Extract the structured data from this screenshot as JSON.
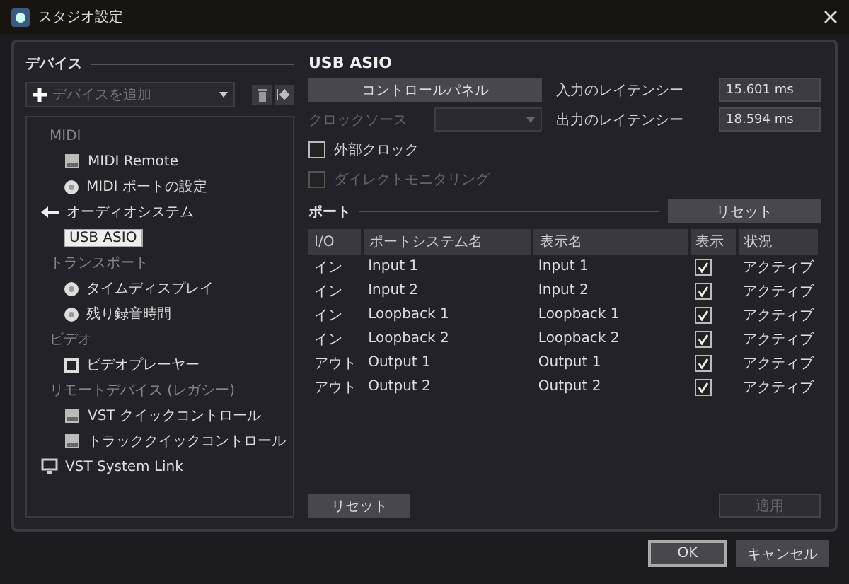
{
  "window": {
    "title": "スタジオ設定"
  },
  "devices": {
    "heading": "デバイス",
    "add_dropdown": {
      "placeholder": "デバイスを追加"
    },
    "tree": [
      {
        "label": "MIDI",
        "kind": "category",
        "selected": false,
        "children": [
          {
            "label": "MIDI Remote",
            "kind": "panel",
            "selected": false
          },
          {
            "label": "MIDI ポートの設定",
            "kind": "dot",
            "selected": false
          }
        ]
      },
      {
        "label": "オーディオシステム",
        "kind": "plug",
        "selected": false,
        "children": [
          {
            "label": "USB ASIO",
            "kind": "plain",
            "selected": true
          }
        ]
      },
      {
        "label": "トランスポート",
        "kind": "category",
        "selected": false,
        "children": [
          {
            "label": "タイムディスプレイ",
            "kind": "dot",
            "selected": false
          },
          {
            "label": "残り録音時間",
            "kind": "dot",
            "selected": false
          }
        ]
      },
      {
        "label": "ビデオ",
        "kind": "category",
        "selected": false,
        "children": [
          {
            "label": "ビデオプレーヤー",
            "kind": "square",
            "selected": false
          }
        ]
      },
      {
        "label": "リモートデバイス (レガシー)",
        "kind": "category",
        "selected": false,
        "children": [
          {
            "label": "VST クイックコントロール",
            "kind": "panel",
            "selected": false
          },
          {
            "label": "トラッククイックコントロール",
            "kind": "panel",
            "selected": false
          }
        ]
      },
      {
        "label": "VST System Link",
        "kind": "monitor",
        "selected": false
      }
    ]
  },
  "detail": {
    "title": "USB ASIO",
    "control_panel_button": "コントロールパネル",
    "clock_source": {
      "label": "クロックソース",
      "disabled": true
    },
    "input_latency": {
      "label": "入力のレイテンシー",
      "value": "15.601 ms"
    },
    "output_latency": {
      "label": "出力のレイテンシー",
      "value": "18.594 ms"
    },
    "options": [
      {
        "label": "外部クロック",
        "checked": false,
        "disabled": false
      },
      {
        "label": "ダイレクトモニタリング",
        "checked": false,
        "disabled": true
      }
    ],
    "ports_heading": "ポート",
    "ports_reset_button": "リセット",
    "table": {
      "columns": [
        "I/O",
        "ポートシステム名",
        "表示名",
        "表示",
        "状況"
      ],
      "rows": [
        {
          "io": "イン",
          "system_name": "Input 1",
          "display_name": "Input 1",
          "visible": true,
          "status": "アクティブ"
        },
        {
          "io": "イン",
          "system_name": "Input 2",
          "display_name": "Input 2",
          "visible": true,
          "status": "アクティブ"
        },
        {
          "io": "イン",
          "system_name": "Loopback 1",
          "display_name": "Loopback 1",
          "visible": true,
          "status": "アクティブ"
        },
        {
          "io": "イン",
          "system_name": "Loopback 2",
          "display_name": "Loopback 2",
          "visible": true,
          "status": "アクティブ"
        },
        {
          "io": "アウト",
          "system_name": "Output 1",
          "display_name": "Output 1",
          "visible": true,
          "status": "アクティブ"
        },
        {
          "io": "アウト",
          "system_name": "Output 2",
          "display_name": "Output 2",
          "visible": true,
          "status": "アクティブ"
        }
      ]
    },
    "reset_button": "リセット",
    "apply_button": {
      "label": "適用",
      "disabled": true
    }
  },
  "footer": {
    "ok_button": "OK",
    "cancel_button": "キャンセル"
  }
}
